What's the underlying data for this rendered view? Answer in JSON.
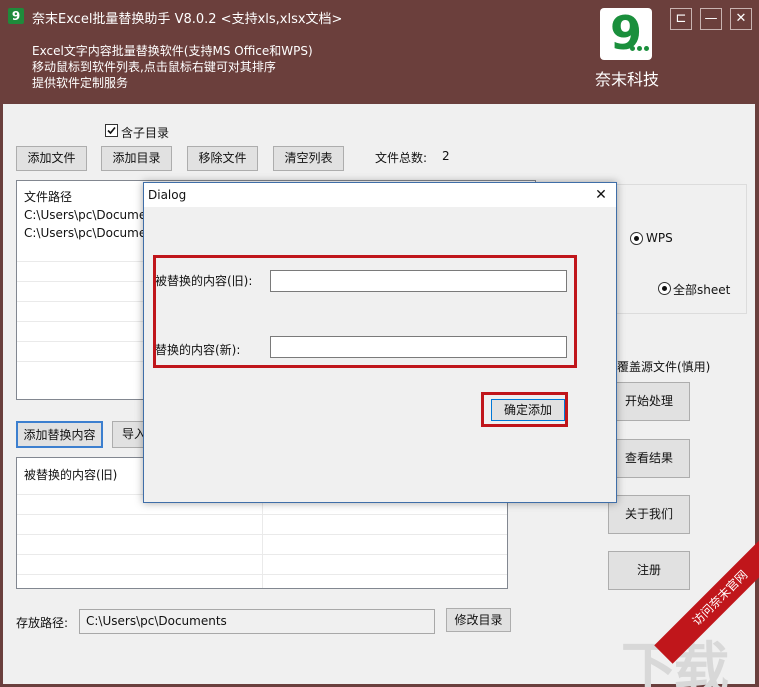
{
  "window": {
    "title": "奈末Excel批量替换助手    V8.0.2    <支持xls,xlsx文档>",
    "app_icon_text": "9",
    "desc_lines": [
      "Excel文字内容批量替换软件(支持MS  Office和WPS)",
      "移动鼠标到软件列表,点击鼠标右键可对其排序",
      "提供软件定制服务"
    ],
    "logo_glyph": "9",
    "logo_text": "奈末科技",
    "controls": {
      "pin": "⊏",
      "minimize": "—",
      "close": "✕"
    }
  },
  "toolbar": {
    "include_subdirs": "含子目录",
    "include_checked": true,
    "add_file": "添加文件",
    "add_dir": "添加目录",
    "remove_file": "移除文件",
    "clear_list": "清空列表",
    "file_total_label": "文件总数:",
    "file_total_value": "2"
  },
  "file_list": {
    "header": "文件路径",
    "rows": [
      "C:\\Users\\pc\\Documen",
      "C:\\Users\\pc\\Documen"
    ]
  },
  "options": {
    "wps_label": "WPS",
    "all_sheet_label": "全部sheet",
    "overwrite_label": "覆盖源文件(慎用)"
  },
  "replace": {
    "add_button": "添加替换内容",
    "import_button": "导入",
    "list_header": "被替换的内容(旧)"
  },
  "side_buttons": {
    "start": "开始处理",
    "view": "查看结果",
    "about": "关于我们",
    "register": "注册"
  },
  "output": {
    "label": "存放路径:",
    "path": "C:\\Users\\pc\\Documents",
    "change_button": "修改目录"
  },
  "dialog": {
    "title": "Dialog",
    "close": "✕",
    "old_label": "被替换的内容(旧):",
    "old_value": "",
    "new_label": "替换的内容(新):",
    "new_value": "",
    "confirm_button": "确定添加"
  },
  "watermark": {
    "band_text": "访问奈末官网"
  },
  "colors": {
    "title_bar": "#6b3f3c",
    "logo_green": "#1a8f3c",
    "highlight_red": "#c0161b",
    "dialog_border": "#3f6ea8"
  }
}
